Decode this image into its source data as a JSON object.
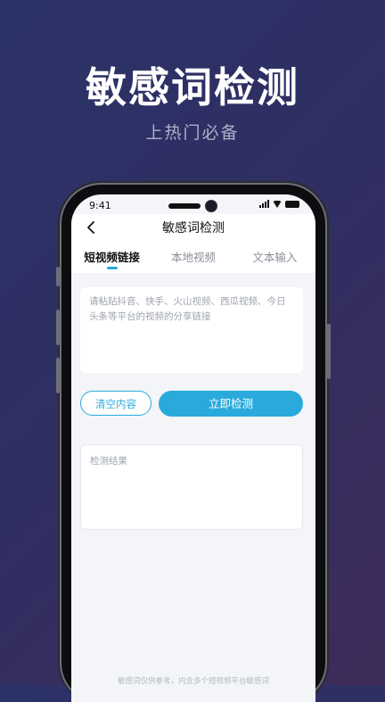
{
  "promo": {
    "title": "敏感词检测",
    "subtitle": "上热门必备"
  },
  "status_bar": {
    "time": "9:41"
  },
  "header": {
    "title": "敏感词检测",
    "back_icon": "chevron-left-icon"
  },
  "tabs": [
    {
      "label": "短视频链接",
      "active": true
    },
    {
      "label": "本地视频",
      "active": false
    },
    {
      "label": "文本输入",
      "active": false
    }
  ],
  "input": {
    "placeholder": "请粘贴抖音、快手、火山视频、西瓜视频、今日头条等平台的视频的分享链接",
    "value": ""
  },
  "buttons": {
    "clear_label": "清空内容",
    "detect_label": "立即检测"
  },
  "result": {
    "label": "检测结果"
  },
  "footer": {
    "note": "敏感词仅供参考，内含多个短视频平台敏感词"
  },
  "colors": {
    "accent": "#2aa9dc",
    "background_start": "#2b3368",
    "background_end": "#3f2c5a"
  }
}
